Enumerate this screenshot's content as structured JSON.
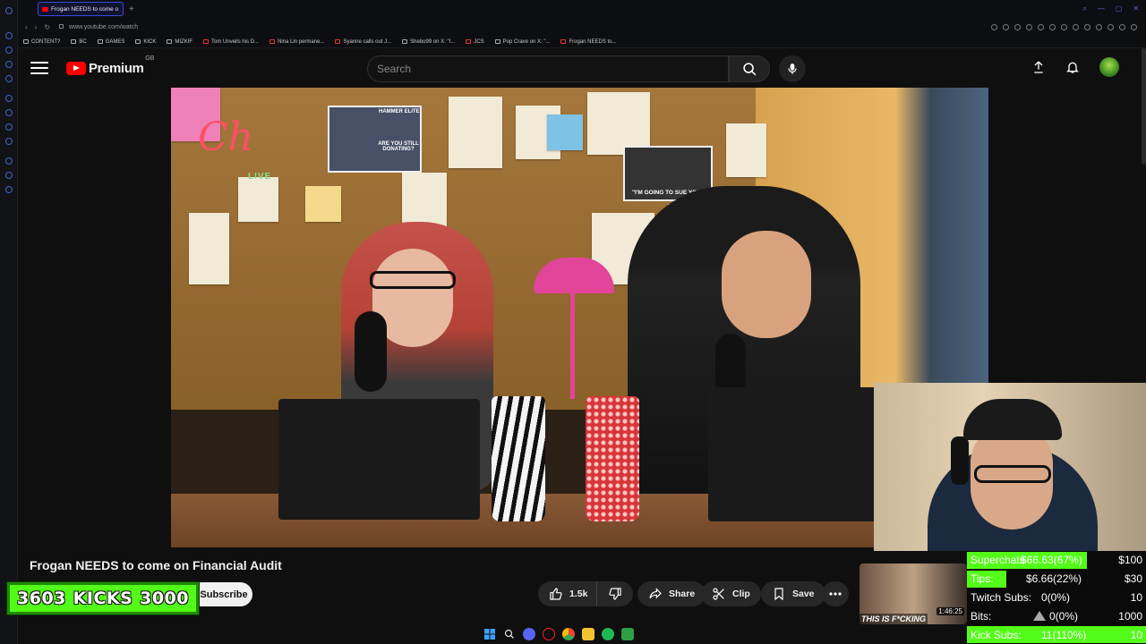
{
  "browser": {
    "tab_title": "Frogan NEEDS to come o",
    "url": "www.youtube.com/watch",
    "bookmarks": [
      "CONTENT?",
      "BC",
      "GAMES",
      "KICK",
      "MIZKIF",
      "Tom Unveils his D...",
      "Nina Lin permane...",
      "Syanne calls out J...",
      "Shebo99 on X: \"I...",
      "JCS",
      "Pop Crave on X: \"...",
      "Frogan NEEDS to..."
    ]
  },
  "header": {
    "logo_text": "Premium",
    "region": "GB",
    "search_placeholder": "Search"
  },
  "video_overlay": {
    "logo": "Ch",
    "live": "LIVE",
    "hammer_title": "HAMMER ELITE",
    "hammer_caption": "ARE YOU STILL DONATING?",
    "sue_caption": "\"I'M GOING TO SUE YOU\""
  },
  "video": {
    "title": "Frogan NEEDS to come on Financial Audit",
    "subscribe_label": "Subscribe",
    "likes": "1.5k",
    "share_label": "Share",
    "clip_label": "Clip",
    "save_label": "Save"
  },
  "kicks_widget": {
    "current": "3603",
    "label": "KICKS",
    "goal": "3000"
  },
  "suggested": {
    "caption": "THIS IS F*CKING",
    "duration": "1:46:25"
  },
  "stats": [
    {
      "label": "Superchats",
      "value": "$66.63(67%)",
      "goal": "$100",
      "fill": 0.67
    },
    {
      "label": "Tips:",
      "value": "$6.66(22%)",
      "goal": "$30",
      "fill": 0.22
    },
    {
      "label": "Twitch Subs:",
      "value": "0(0%)",
      "goal": "10",
      "fill": 0
    },
    {
      "label": "Bits:",
      "value": "0(0%)",
      "goal": "1000",
      "fill": 0
    },
    {
      "label": "Kick Subs:",
      "value": "11(110%)",
      "goal": "10",
      "fill": 1.0
    }
  ],
  "colors": {
    "accent_kick": "#53fc18",
    "youtube_red": "#ff0000",
    "background": "#0f0f0f"
  }
}
